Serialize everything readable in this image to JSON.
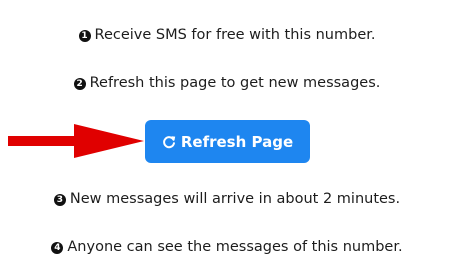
{
  "steps": [
    {
      "number": "1",
      "text": "Receive SMS for free with this number."
    },
    {
      "number": "2",
      "text": "Refresh this page to get new messages."
    },
    {
      "number": "3",
      "text": "New messages will arrive in about 2 minutes."
    },
    {
      "number": "4",
      "text": "Anyone can see the messages of this number."
    }
  ],
  "refresh_button": {
    "label": "Refresh Page",
    "icon": "refresh-icon",
    "color": "#1e86f0"
  },
  "pointer_arrow": {
    "icon": "red-arrow-right",
    "color": "#e00000"
  }
}
